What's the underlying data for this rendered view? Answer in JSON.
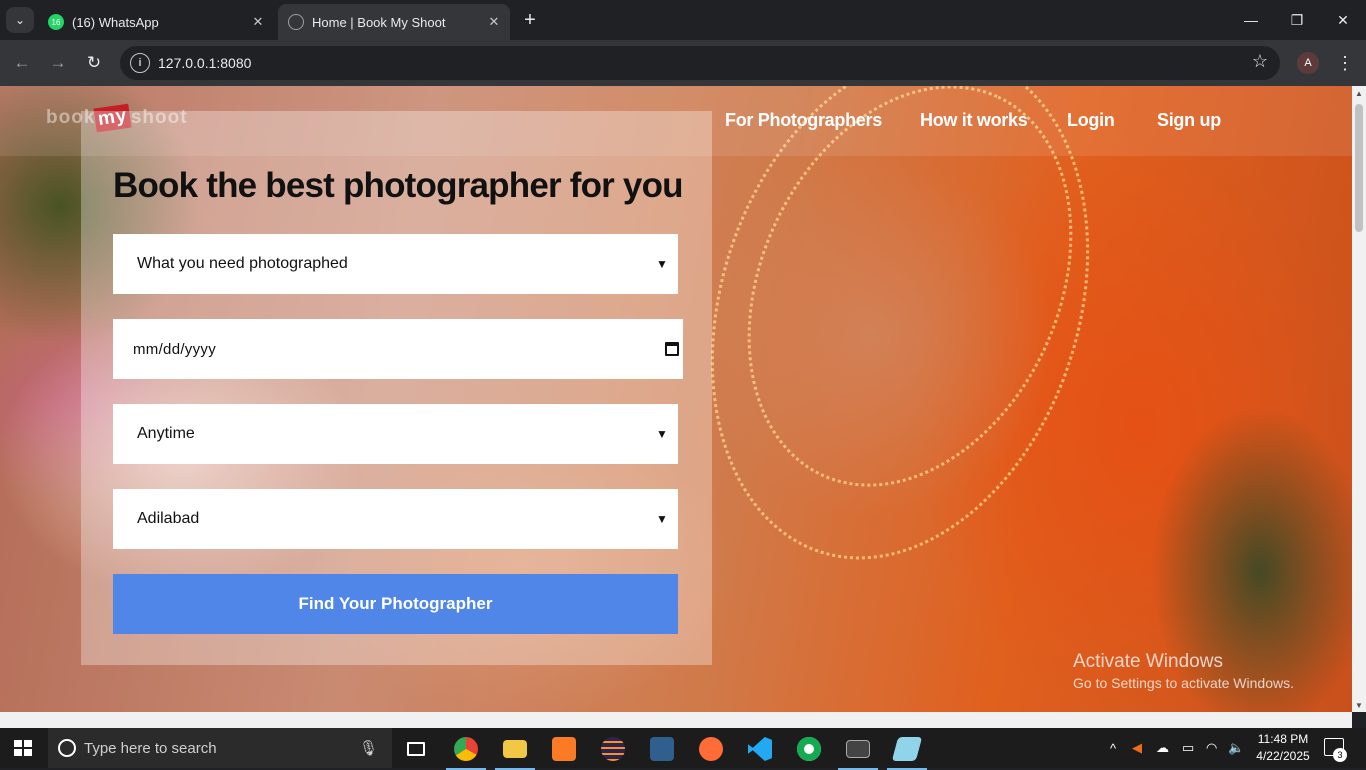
{
  "browser": {
    "tabs": [
      {
        "title": "(16) WhatsApp",
        "badge": "16"
      },
      {
        "title": "Home | Book My Shoot"
      }
    ],
    "url": "127.0.0.1:8080",
    "profile_initial": "A",
    "accent": "#35363a"
  },
  "site": {
    "logo": {
      "left": "book",
      "middle": "my",
      "right": "shoot"
    },
    "nav": [
      "For Photographers",
      "How it works",
      "Login",
      "Sign up"
    ],
    "hero": {
      "headline": "Book the best photographer for you",
      "fields": {
        "category": "What you need photographed",
        "date_placeholder": "mm/dd/yyyy",
        "time": "Anytime",
        "city": "Adilabad"
      },
      "submit": "Find Your Photographer",
      "submit_color": "#4f86e8"
    }
  },
  "watermark": {
    "title": "Activate Windows",
    "subtitle": "Go to Settings to activate Windows."
  },
  "taskbar": {
    "search_placeholder": "Type here to search",
    "time": "11:48 PM",
    "date": "4/22/2025",
    "notifications": "3"
  }
}
